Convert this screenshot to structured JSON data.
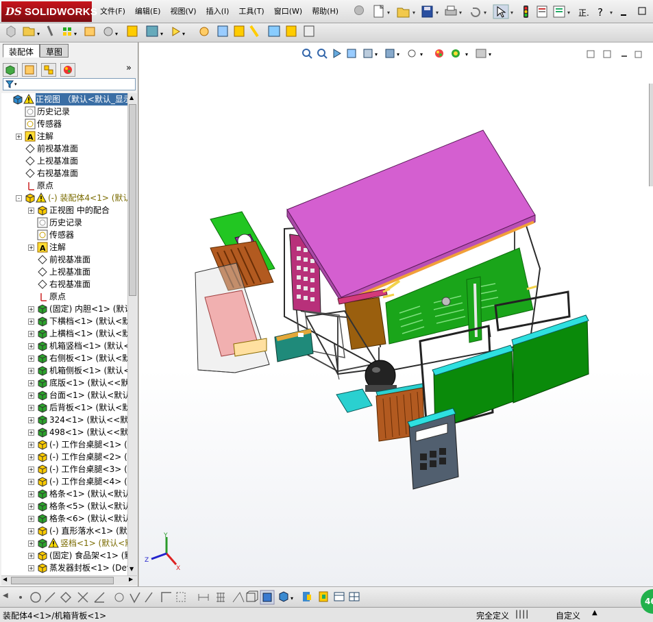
{
  "app": {
    "logo_prefix": "DS",
    "logo_text": "SOLIDWORKS"
  },
  "menu": [
    "文件(F)",
    "编辑(E)",
    "视图(V)",
    "插入(I)",
    "工具(T)",
    "窗口(W)",
    "帮助(H)"
  ],
  "toolbar_right_text": "正.",
  "left_panel": {
    "tabs": [
      {
        "label": "装配体",
        "active": true
      },
      {
        "label": "草图",
        "active": false
      }
    ]
  },
  "tree": [
    {
      "label": "正视图 （默认<默认_显示状",
      "level": 0,
      "icon": "assembly-icon",
      "warn": true,
      "selected": true,
      "expander": ""
    },
    {
      "label": "历史记录",
      "level": 1,
      "icon": "history-icon"
    },
    {
      "label": "传感器",
      "level": 1,
      "icon": "sensor-icon"
    },
    {
      "label": "注解",
      "level": 1,
      "icon": "annotation-icon",
      "expander": "+"
    },
    {
      "label": "前视基准面",
      "level": 1,
      "icon": "plane-icon"
    },
    {
      "label": "上视基准面",
      "level": 1,
      "icon": "plane-icon"
    },
    {
      "label": "右视基准面",
      "level": 1,
      "icon": "plane-icon"
    },
    {
      "label": "原点",
      "level": 1,
      "icon": "origin-icon"
    },
    {
      "label": "(-) 装配体4<1> (默认<",
      "level": 1,
      "icon": "subassembly-icon",
      "warn": true,
      "expander": "-",
      "yellow": true
    },
    {
      "label": "正视图 中的配合",
      "level": 2,
      "icon": "mates-icon",
      "expander": "+"
    },
    {
      "label": "历史记录",
      "level": 2,
      "icon": "history-icon"
    },
    {
      "label": "传感器",
      "level": 2,
      "icon": "sensor-icon"
    },
    {
      "label": "注解",
      "level": 2,
      "icon": "annotation-icon",
      "expander": "+"
    },
    {
      "label": "前视基准面",
      "level": 2,
      "icon": "plane-icon"
    },
    {
      "label": "上视基准面",
      "level": 2,
      "icon": "plane-icon"
    },
    {
      "label": "右视基准面",
      "level": 2,
      "icon": "plane-icon"
    },
    {
      "label": "原点",
      "level": 2,
      "icon": "origin-icon"
    },
    {
      "label": "(固定) 内胆<1> (默认<",
      "level": 2,
      "icon": "part-icon",
      "expander": "+"
    },
    {
      "label": "下横档<1> (默认<默认",
      "level": 2,
      "icon": "part-icon",
      "expander": "+"
    },
    {
      "label": "上横档<1> (默认<默认",
      "level": 2,
      "icon": "part-icon",
      "expander": "+"
    },
    {
      "label": "机箱竖档<1> (默认<默",
      "level": 2,
      "icon": "part-icon",
      "expander": "+"
    },
    {
      "label": "右侧板<1> (默认<默认",
      "level": 2,
      "icon": "part-icon",
      "expander": "+"
    },
    {
      "label": "机箱侧板<1> (默认<默",
      "level": 2,
      "icon": "part-icon",
      "expander": "+"
    },
    {
      "label": "底版<1> (默认<<默认>_",
      "level": 2,
      "icon": "part-icon",
      "expander": "+"
    },
    {
      "label": "台面<1> (默认<默认_显",
      "level": 2,
      "icon": "part-icon",
      "expander": "+"
    },
    {
      "label": "后背板<1> (默认<默认",
      "level": 2,
      "icon": "part-icon",
      "expander": "+"
    },
    {
      "label": "324<1> (默认<<默认>_显",
      "level": 2,
      "icon": "part-icon",
      "expander": "+"
    },
    {
      "label": "498<1> (默认<<默认>_显",
      "level": 2,
      "icon": "part-icon",
      "expander": "+"
    },
    {
      "label": "(-) 工作台桌腿<1> (De",
      "level": 2,
      "icon": "part-icon-yellow",
      "expander": "+"
    },
    {
      "label": "(-) 工作台桌腿<2> (De",
      "level": 2,
      "icon": "part-icon-yellow",
      "expander": "+"
    },
    {
      "label": "(-) 工作台桌腿<3> (De",
      "level": 2,
      "icon": "part-icon-yellow",
      "expander": "+"
    },
    {
      "label": "(-) 工作台桌腿<4> (De",
      "level": 2,
      "icon": "part-icon-yellow",
      "expander": "+"
    },
    {
      "label": "格条<1> (默认<默认_显",
      "level": 2,
      "icon": "part-icon",
      "expander": "+"
    },
    {
      "label": "格条<5> (默认<默认_显",
      "level": 2,
      "icon": "part-icon",
      "expander": "+"
    },
    {
      "label": "格条<6> (默认<默认_显",
      "level": 2,
      "icon": "part-icon",
      "expander": "+"
    },
    {
      "label": "(-) 直形落水<1> (默认",
      "level": 2,
      "icon": "part-icon-yellow",
      "expander": "+"
    },
    {
      "label": "竖档<1> (默认<默认",
      "level": 2,
      "icon": "part-icon",
      "warn": true,
      "expander": "+",
      "yellow": true
    },
    {
      "label": "(固定) 食品架<1> (默认",
      "level": 2,
      "icon": "part-icon-yellow",
      "expander": "+"
    },
    {
      "label": "蒸发器封板<1> (Defaul",
      "level": 2,
      "icon": "part-icon-yellow",
      "expander": "+"
    }
  ],
  "triad": {
    "x_label": "X",
    "y_label": "Y",
    "z_label": "Z"
  },
  "status": {
    "left": "装配体4<1>/机箱背板<1>",
    "mid": "完全定义",
    "right": "自定义",
    "badge": "46"
  },
  "colors": {
    "tabletop": "#d45fd0",
    "panel_green": "#00a000",
    "accent_cyan": "#22dddd",
    "selection": "#3a6ea5"
  }
}
